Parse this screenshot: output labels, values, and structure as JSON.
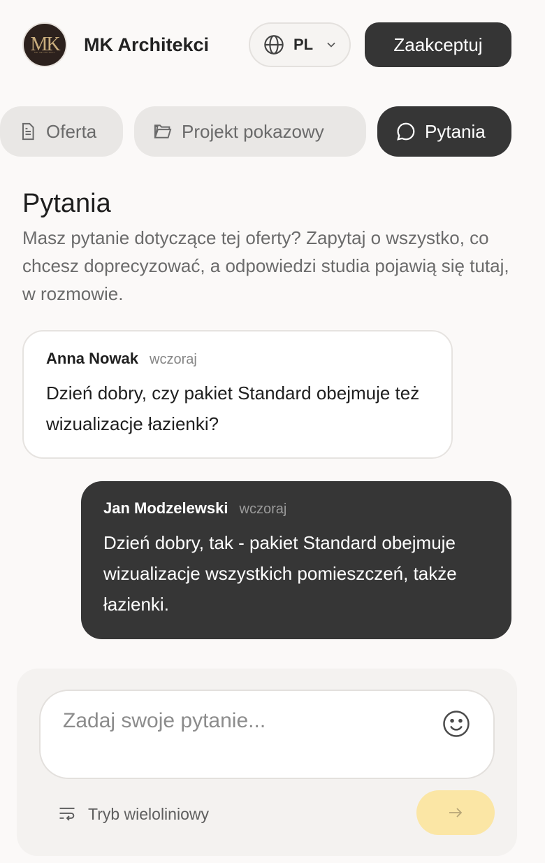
{
  "header": {
    "logo_text": "MK",
    "logo_sub": "MK ARCHITEKCI",
    "brand": "MK Architekci",
    "lang_code": "PL",
    "accept_label": "Zaakceptuj"
  },
  "tabs": [
    {
      "label": "Oferta",
      "icon": "document-icon",
      "active": false
    },
    {
      "label": "Projekt pokazowy",
      "icon": "folder-icon",
      "active": false
    },
    {
      "label": "Pytania",
      "icon": "chat-bubble-icon",
      "active": true
    }
  ],
  "section": {
    "title": "Pytania",
    "description": "Masz pytanie dotyczące tej oferty? Zapytaj o wszystko, co chcesz doprecyzować, a odpowiedzi studia pojawią się tutaj, w rozmowie."
  },
  "messages": [
    {
      "author": "Anna Nowak",
      "time": "wczoraj",
      "text": "Dzień dobry, czy pakiet Standard obejmuje też wizualizacje łazienki?",
      "direction": "incoming"
    },
    {
      "author": "Jan Modzelewski",
      "time": "wczoraj",
      "text": "Dzień dobry, tak - pakiet Standard obejmuje wizualizacje wszystkich pomieszczeń, także łazienki.",
      "direction": "outgoing"
    }
  ],
  "composer": {
    "placeholder": "Zadaj swoje pytanie...",
    "multiline_label": "Tryb wieloliniowy"
  },
  "colors": {
    "accent_dark": "#363636",
    "send_button": "#fbe6a5",
    "logo_bg": "#2c211d",
    "logo_gold": "#c9ad7d"
  }
}
